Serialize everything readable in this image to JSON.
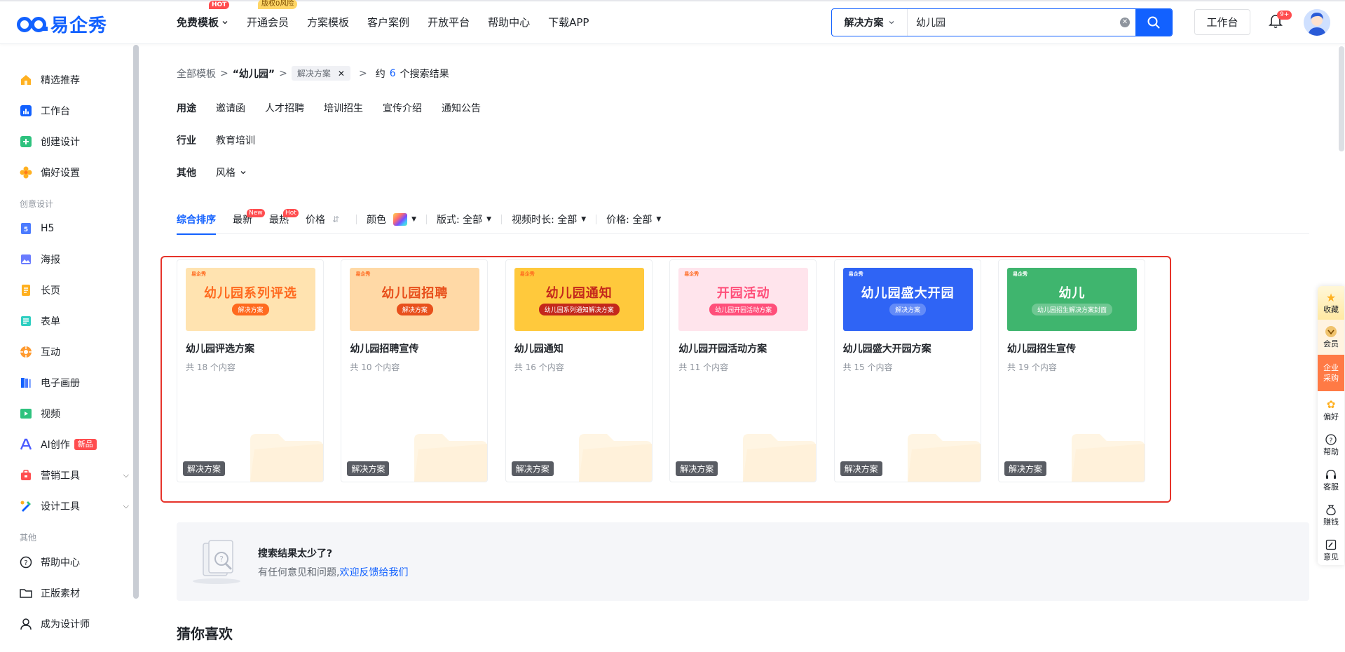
{
  "brand": {
    "name": "易企秀",
    "color": "#1261ff"
  },
  "topnav": {
    "items": [
      {
        "label": "免费模板",
        "badge": "HOT"
      },
      {
        "label": "开通会员",
        "badge": "版权0风险"
      },
      {
        "label": "方案模板"
      },
      {
        "label": "客户案例"
      },
      {
        "label": "开放平台"
      },
      {
        "label": "帮助中心"
      },
      {
        "label": "下载APP"
      }
    ]
  },
  "search": {
    "scope": "解决方案",
    "value": "幼儿园",
    "placeholder": ""
  },
  "header": {
    "workbench": "工作台",
    "notifications": "9+"
  },
  "sidebar": {
    "items": [
      {
        "label": "精选推荐",
        "icon": "house-icon"
      },
      {
        "label": "工作台",
        "icon": "chart-icon"
      },
      {
        "label": "创建设计",
        "icon": "plus-icon"
      },
      {
        "label": "偏好设置",
        "icon": "flower-icon"
      }
    ],
    "group_creative": "创意设计",
    "creative": [
      {
        "label": "H5",
        "icon": "h5-icon"
      },
      {
        "label": "海报",
        "icon": "image-icon"
      },
      {
        "label": "长页",
        "icon": "page-icon"
      },
      {
        "label": "表单",
        "icon": "form-icon"
      },
      {
        "label": "互动",
        "icon": "interact-icon"
      },
      {
        "label": "电子画册",
        "icon": "book-icon"
      },
      {
        "label": "视频",
        "icon": "video-icon"
      },
      {
        "label": "AI创作",
        "icon": "ai-icon",
        "badge": "新品"
      },
      {
        "label": "营销工具",
        "icon": "marketing-icon"
      },
      {
        "label": "设计工具",
        "icon": "design-icon"
      }
    ],
    "group_other": "其他",
    "other": [
      {
        "label": "帮助中心",
        "icon": "help-icon"
      },
      {
        "label": "正版素材",
        "icon": "folder-icon"
      },
      {
        "label": "成为设计师",
        "icon": "user-icon"
      }
    ]
  },
  "breadcrumb": {
    "root": "全部模板",
    "sep": ">",
    "query": "“幼儿园”",
    "tag": "解决方案",
    "prefix": "约",
    "count": "6",
    "suffix": "个搜索结果"
  },
  "filters": {
    "usage_label": "用途",
    "usage": [
      "邀请函",
      "人才招聘",
      "培训招生",
      "宣传介绍",
      "通知公告"
    ],
    "industry_label": "行业",
    "industry": [
      "教育培训"
    ],
    "other_label": "其他",
    "other": "风格"
  },
  "sort": {
    "comprehensive": "综合排序",
    "newest": "最新",
    "newest_badge": "New",
    "hottest": "最热",
    "hottest_badge": "Hot",
    "price": "价格",
    "color": "颜色",
    "layout": "版式: 全部",
    "duration": "视频时长: 全部",
    "price_filter": "价格: 全部"
  },
  "cards": [
    {
      "title": "幼儿园评选方案",
      "count": "共 18 个内容",
      "tag": "解决方案",
      "thumb_title": "幼儿园系列评选",
      "thumb_sub": "解决方案",
      "bg": "#ffe3b0",
      "fg": "#ff6a1f"
    },
    {
      "title": "幼儿园招聘宣传",
      "count": "共 10 个内容",
      "tag": "解决方案",
      "thumb_title": "幼儿园招聘",
      "thumb_sub": "解决方案",
      "bg": "#ffd9a6",
      "fg": "#e8501c"
    },
    {
      "title": "幼儿园通知",
      "count": "共 16 个内容",
      "tag": "解决方案",
      "thumb_title": "幼儿园通知",
      "thumb_sub": "幼儿园系列通知解决方案",
      "bg": "#ffc93c",
      "fg": "#c4281c"
    },
    {
      "title": "幼儿园开园活动方案",
      "count": "共 11 个内容",
      "tag": "解决方案",
      "thumb_title": "开园活动",
      "thumb_sub": "幼儿园开园活动方案",
      "bg": "#ffe4ec",
      "fg": "#ff4f7a"
    },
    {
      "title": "幼儿园盛大开园方案",
      "count": "共 15 个内容",
      "tag": "解决方案",
      "thumb_title": "幼儿园盛大开园",
      "thumb_sub": "解决方案",
      "bg": "#2f64f5",
      "fg": "#ffffff"
    },
    {
      "title": "幼儿园招生宣传",
      "count": "共 19 个内容",
      "tag": "解决方案",
      "thumb_title": "幼儿",
      "thumb_sub": "幼儿园招生解决方案封面",
      "bg": "#3fb56e",
      "fg": "#ffffff"
    }
  ],
  "feedback": {
    "title": "搜索结果太少了?",
    "text": "有任何意见和问题,",
    "link": "欢迎反馈给我们"
  },
  "guess": "猜你喜欢",
  "right_float": [
    {
      "label": "收藏"
    },
    {
      "label": "会员"
    },
    {
      "label": "企业采购"
    },
    {
      "label": "偏好"
    },
    {
      "label": "帮助"
    },
    {
      "label": "客服"
    },
    {
      "label": "赚钱"
    },
    {
      "label": "意见"
    }
  ]
}
